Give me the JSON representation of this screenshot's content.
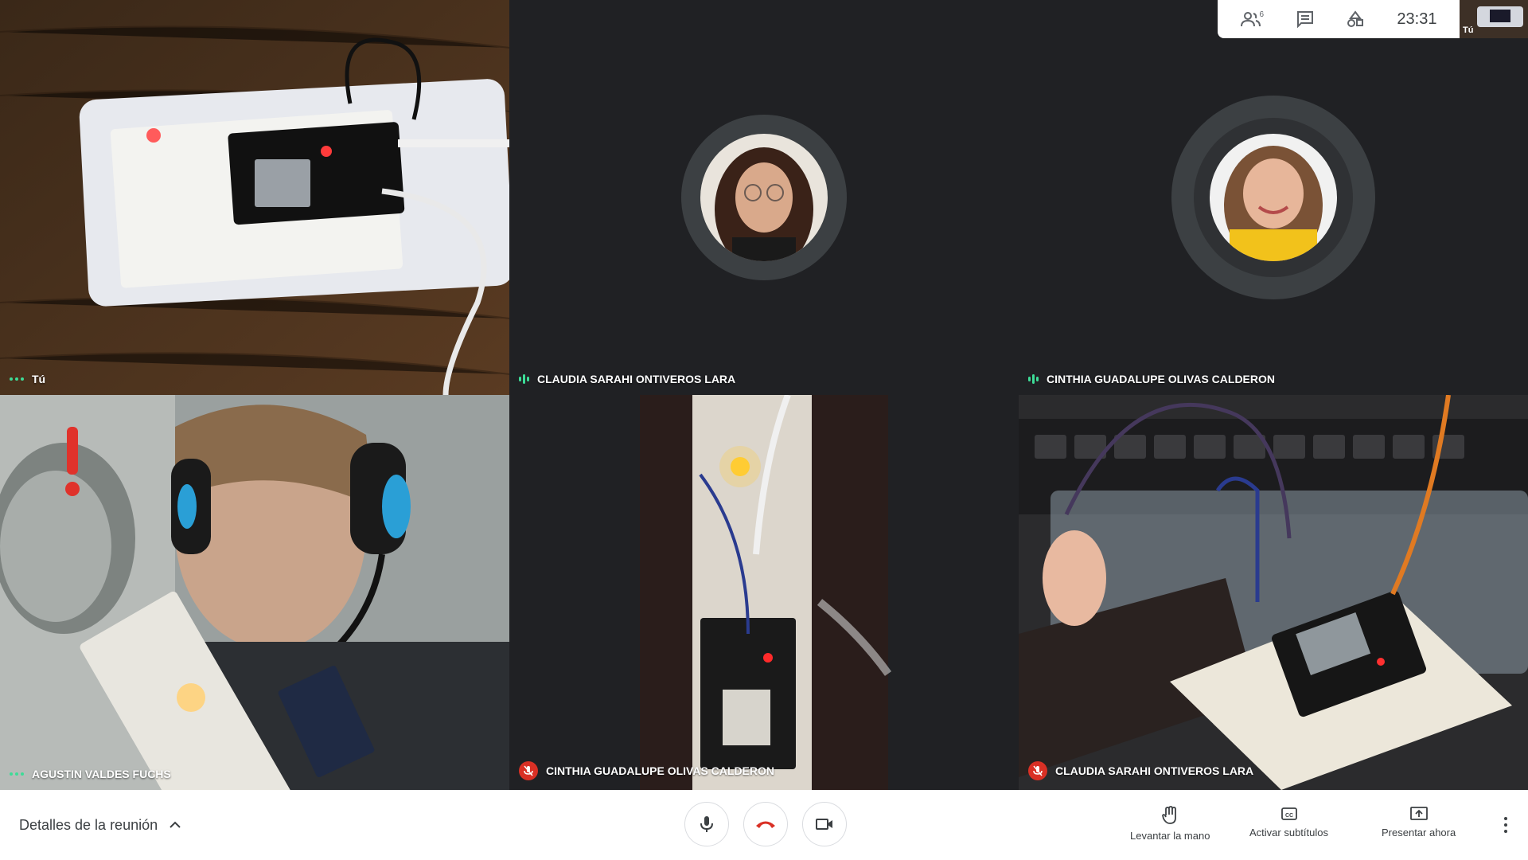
{
  "topbar": {
    "participants_icon": "people-icon",
    "participants_count": "6",
    "chat_icon": "chat-icon",
    "activities_icon": "activities-icon",
    "clock": "23:31",
    "self_thumbnail_label": "Tú"
  },
  "tiles": [
    {
      "name": "Tú",
      "indicator": "dots"
    },
    {
      "name": "CLAUDIA SARAHI ONTIVEROS LARA",
      "indicator": "speaking"
    },
    {
      "name": "CINTHIA GUADALUPE OLIVAS CALDERON",
      "indicator": "speaking"
    },
    {
      "name": "AGUSTIN VALDES FUCHS",
      "indicator": "dots"
    },
    {
      "name": "CINTHIA GUADALUPE OLIVAS CALDERON",
      "indicator": "muted"
    },
    {
      "name": "CLAUDIA SARAHI ONTIVEROS LARA",
      "indicator": "muted"
    }
  ],
  "bottombar": {
    "meeting_details": "Detalles de la reunión",
    "mic_icon": "microphone-icon",
    "hangup_icon": "hang-up-icon",
    "camera_icon": "camera-icon",
    "raise_hand": "Levantar la mano",
    "captions": "Activar subtítulos",
    "present": "Presentar ahora",
    "more_icon": "more-vert-icon"
  },
  "colors": {
    "background": "#202124",
    "accent_green": "#3ddc97",
    "muted_red": "#d93025",
    "hangup_red": "#d93025"
  }
}
